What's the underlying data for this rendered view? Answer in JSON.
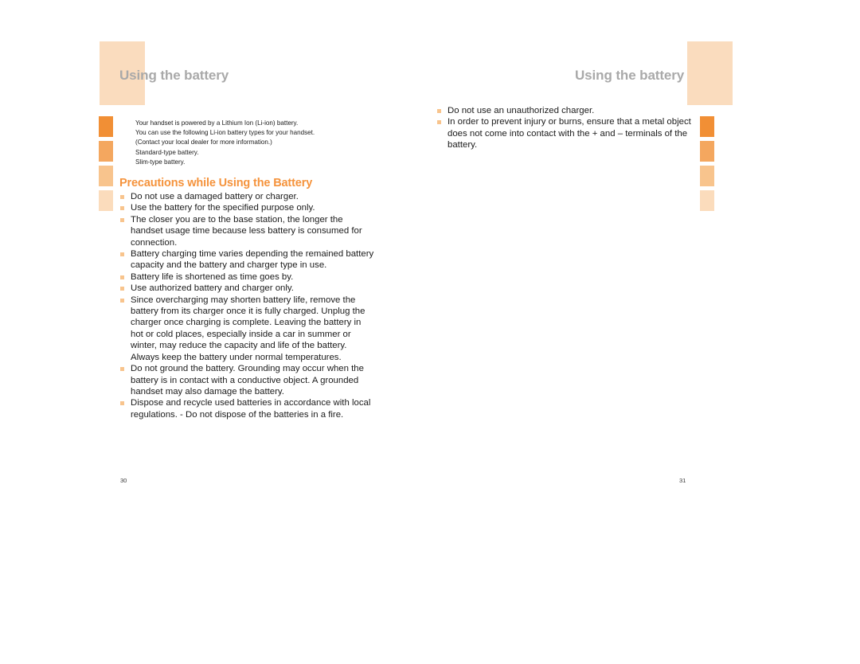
{
  "document": {
    "type": "user-manual-spread",
    "colors": {
      "header_block": "#FADCBE",
      "header_text": "#A9A9A9",
      "section_title": "#F5933C",
      "bullet_marker": "#F8C48D",
      "tab_1": "#F18F35",
      "tab_2": "#F4A75F",
      "tab_3": "#F8C48D",
      "tab_4": "#FBDCBC",
      "body_text": "#1b1b1b",
      "page_background": "#FFFFFF"
    }
  },
  "left_page": {
    "header": {
      "title": "Using the battery",
      "block_icon": "header-color-block"
    },
    "tabs": [
      {
        "name": "tab-marker-1",
        "color": "#F18F35"
      },
      {
        "name": "tab-marker-2",
        "color": "#F4A75F"
      },
      {
        "name": "tab-marker-3",
        "color": "#F8C48D"
      },
      {
        "name": "tab-marker-4",
        "color": "#FBDCBC"
      }
    ],
    "intro_lines": [
      "Your handset is powered by a Lithium Ion (Li-ion) battery.",
      "You can use the following Li-ion battery types for your handset.",
      "(Contact your local dealer for more information.)",
      "Standard-type battery.",
      "Slim-type battery."
    ],
    "section_title": "Precautions while Using the Battery",
    "bullets": [
      "Do not use a damaged battery or charger.",
      "Use the battery for the specified purpose only.",
      "The closer you are to the base station, the longer the handset usage time because less battery is consumed for connection.",
      "Battery charging time varies depending the remained battery capacity and the battery and charger type in use.",
      "Battery life is shortened as time goes by.",
      "Use authorized battery and charger only.",
      "Since overcharging may shorten battery life, remove the battery from its charger once it is fully charged. Unplug the charger once charging is complete. Leaving the battery in hot or cold places, especially inside a car in summer or winter, may reduce the capacity and life of the battery.  Always keep the battery under normal temperatures.",
      "Do not ground the battery. Grounding may occur when the battery is in contact with a conductive object. A grounded handset may also damage the battery.",
      "Dispose and recycle used batteries in accordance with local regulations. - Do not dispose of the batteries in a fire."
    ],
    "page_number": "30"
  },
  "right_page": {
    "header": {
      "title": "Using the battery",
      "block_icon": "header-color-block"
    },
    "tabs": [
      {
        "name": "tab-marker-1",
        "color": "#F18F35"
      },
      {
        "name": "tab-marker-2",
        "color": "#F4A75F"
      },
      {
        "name": "tab-marker-3",
        "color": "#F8C48D"
      },
      {
        "name": "tab-marker-4",
        "color": "#FBDCBC"
      }
    ],
    "bullets": [
      "Do not use an unauthorized charger.",
      "In order to prevent injury or burns, ensure that a metal object does not come into contact with the + and – terminals of the battery."
    ],
    "page_number": "31"
  }
}
